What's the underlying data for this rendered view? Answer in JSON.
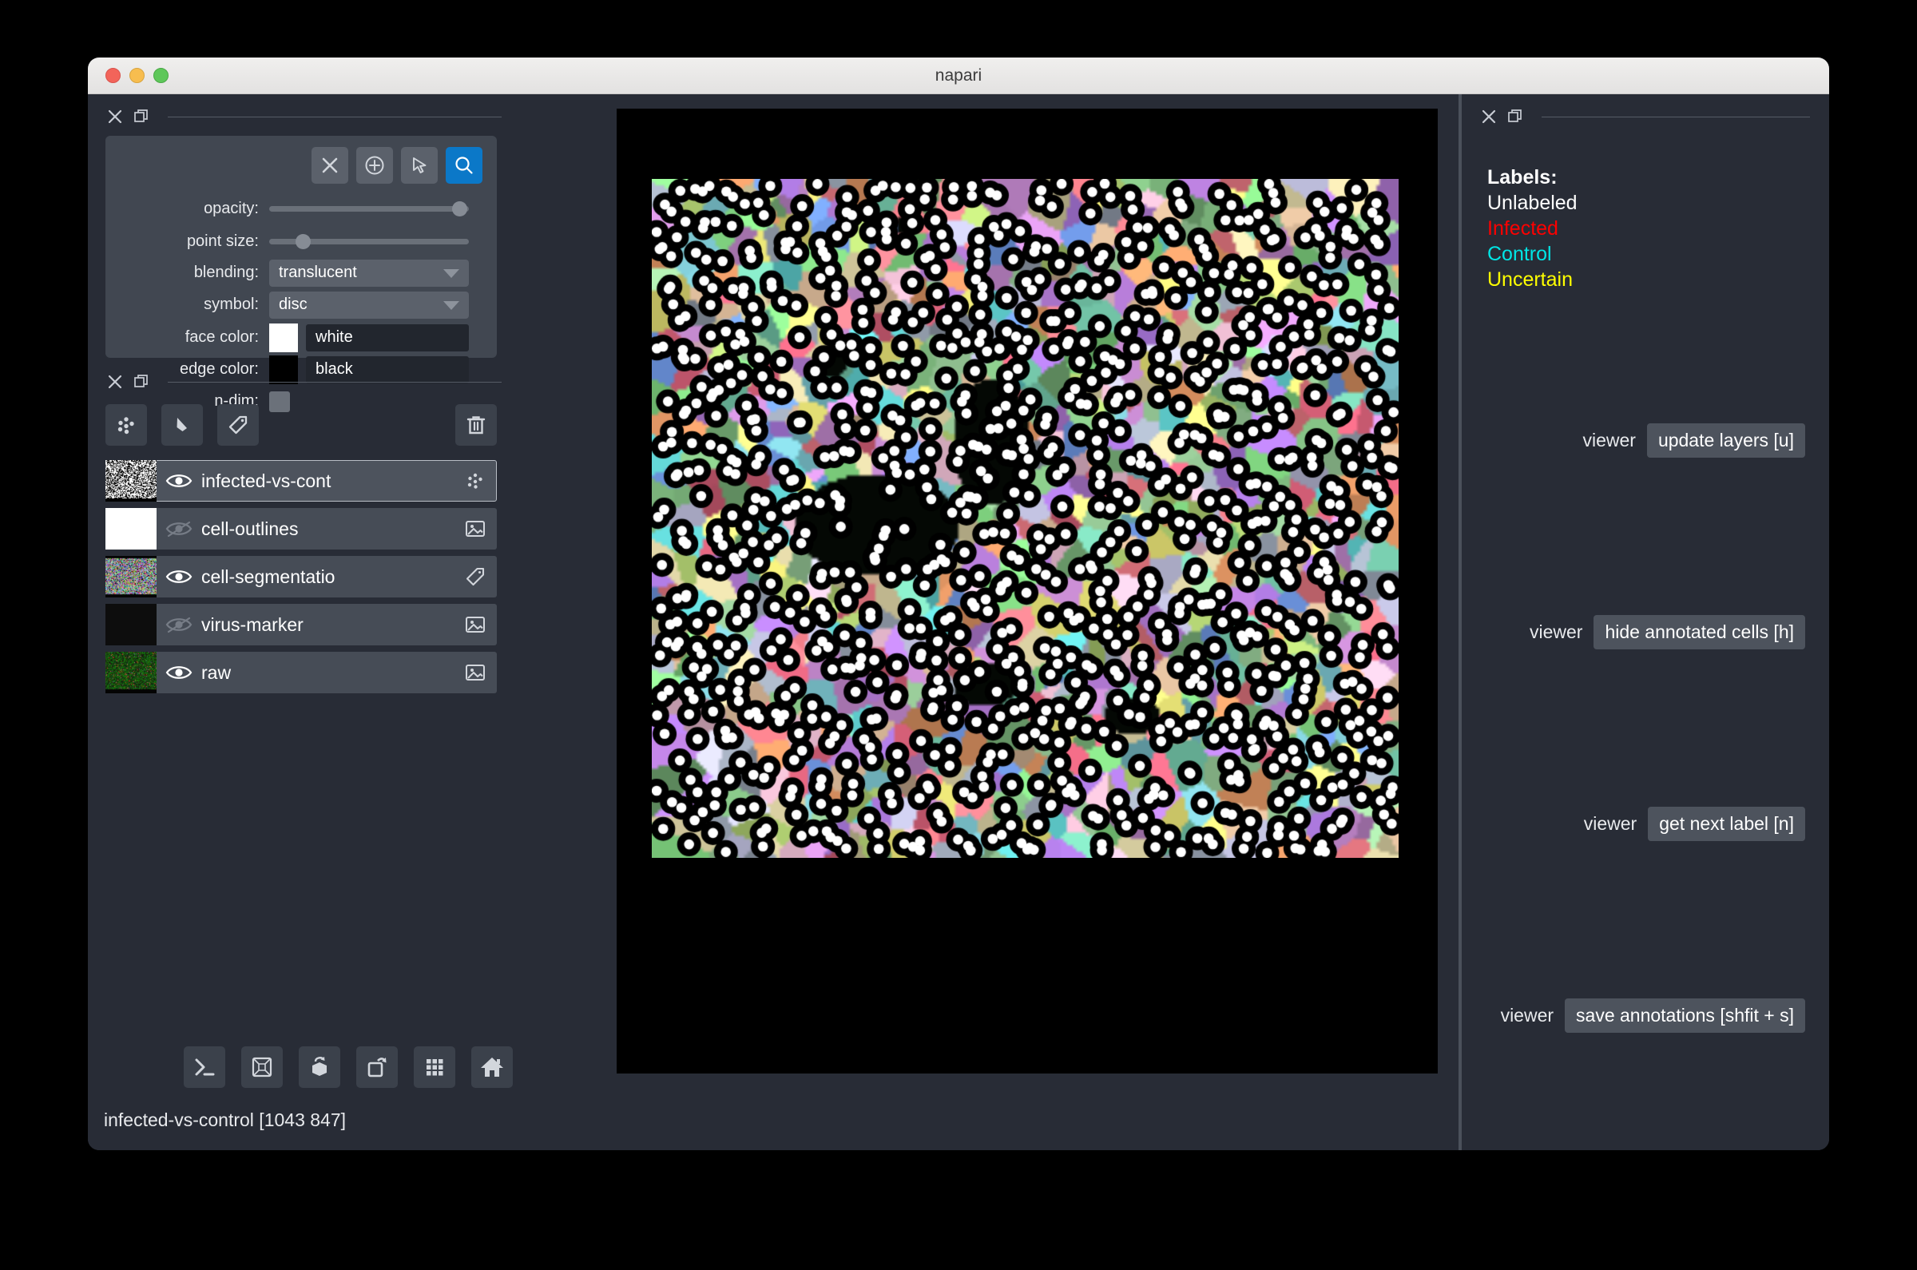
{
  "window": {
    "title": "napari",
    "traffic_lights": [
      "close",
      "minimize",
      "maximize"
    ]
  },
  "left_dock": {
    "points_controls": {
      "tools": [
        {
          "name": "delete-selected-points",
          "icon": "x-icon",
          "active": false
        },
        {
          "name": "add-points",
          "icon": "plus-circle-icon",
          "active": false
        },
        {
          "name": "select-points",
          "icon": "cursor-arrow-icon",
          "active": false
        },
        {
          "name": "pan-zoom",
          "icon": "magnifier-icon",
          "active": true
        }
      ],
      "opacity": {
        "label": "opacity:",
        "value": 100,
        "min": 0,
        "max": 100
      },
      "point_size": {
        "label": "point size:",
        "value": 14,
        "min": 0,
        "max": 100
      },
      "blending": {
        "label": "blending:",
        "value": "translucent"
      },
      "symbol": {
        "label": "symbol:",
        "value": "disc"
      },
      "face_color": {
        "label": "face color:",
        "value": "white",
        "hex": "#ffffff"
      },
      "edge_color": {
        "label": "edge color:",
        "value": "black",
        "hex": "#000000"
      },
      "n_dim": {
        "label": "n-dim:",
        "checked": false
      }
    },
    "layer_buttons": [
      {
        "name": "new-points-layer",
        "icon": "points-icon"
      },
      {
        "name": "new-shapes-layer",
        "icon": "shapes-icon"
      },
      {
        "name": "new-labels-layer",
        "icon": "labels-tag-icon"
      },
      {
        "name": "delete-layer",
        "icon": "trash-icon"
      }
    ],
    "layers": [
      {
        "name": "infected-vs-cont",
        "visible": true,
        "selected": true,
        "type_icon": "points-icon",
        "thumb": "noise-bw"
      },
      {
        "name": "cell-outlines",
        "visible": false,
        "selected": false,
        "type_icon": "image-icon",
        "thumb": "white"
      },
      {
        "name": "cell-segmentatio",
        "visible": true,
        "selected": false,
        "type_icon": "labels-tag-icon",
        "thumb": "noise-color"
      },
      {
        "name": "virus-marker",
        "visible": false,
        "selected": false,
        "type_icon": "image-icon",
        "thumb": "black"
      },
      {
        "name": "raw",
        "visible": true,
        "selected": false,
        "type_icon": "image-icon",
        "thumb": "noise-green"
      }
    ],
    "viewer_buttons": [
      {
        "name": "console-button",
        "icon": "console-icon"
      },
      {
        "name": "toggle-ndisplay-button",
        "icon": "wireframe-cube-icon"
      },
      {
        "name": "roll-dims-button",
        "icon": "roll-cube-icon"
      },
      {
        "name": "transpose-dims-button",
        "icon": "transpose-square-icon"
      },
      {
        "name": "grid-view-button",
        "icon": "grid-icon"
      },
      {
        "name": "home-button",
        "icon": "home-icon"
      }
    ],
    "status_bar": "infected-vs-control [1043  847]"
  },
  "right_dock": {
    "labels_panel": {
      "header": "Labels:",
      "entries": [
        {
          "text": "Unlabeled",
          "color": "#ffffff"
        },
        {
          "text": "Infected",
          "color": "#ff0000"
        },
        {
          "text": "Control",
          "color": "#00e5e5"
        },
        {
          "text": "Uncertain",
          "color": "#ffff00"
        }
      ]
    },
    "actions": [
      {
        "owner": "viewer",
        "label": "update layers [u]"
      },
      {
        "owner": "viewer",
        "label": "hide annotated cells [h]"
      },
      {
        "owner": "viewer",
        "label": "get next label [n]"
      },
      {
        "owner": "viewer",
        "label": "save annotations [shfit + s]"
      }
    ]
  },
  "canvas": {
    "background": "#000000",
    "points_layer": {
      "face_color": "#ffffff",
      "edge_color": "#000000",
      "count": 1043
    }
  }
}
